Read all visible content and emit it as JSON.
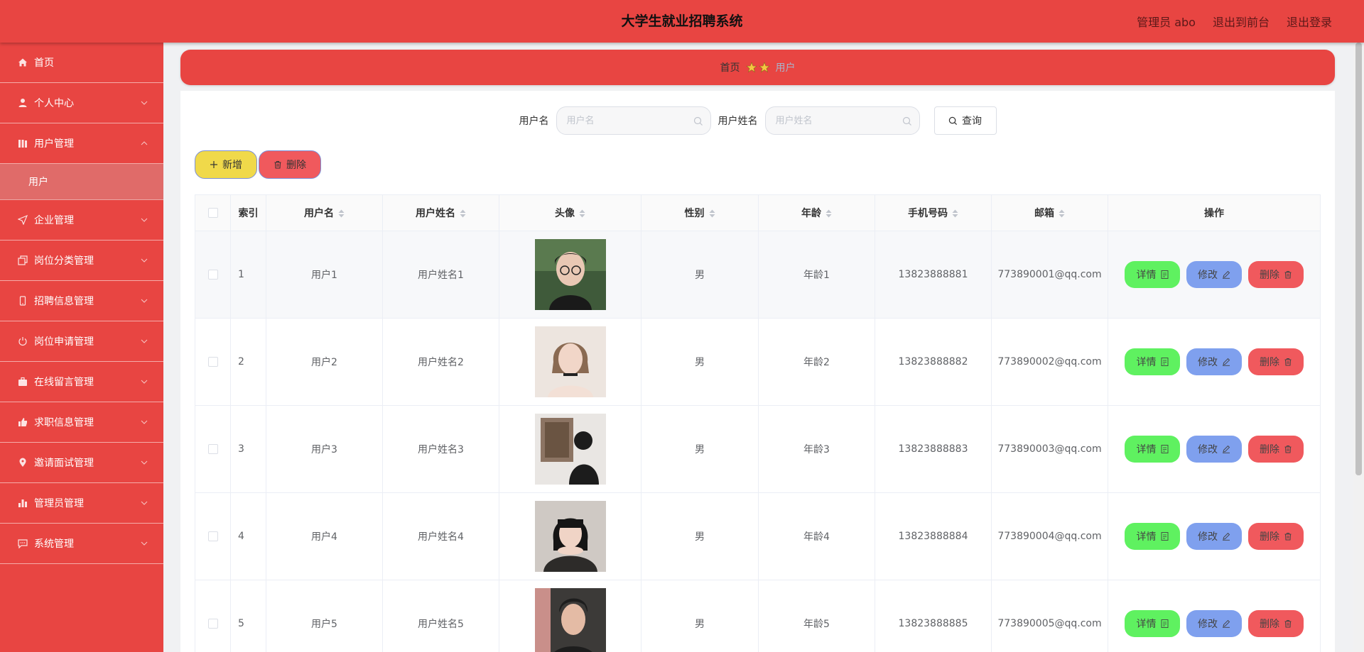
{
  "header": {
    "title": "大学生就业招聘系统",
    "admin_label": "管理员 abo",
    "to_front": "退出到前台",
    "logout": "退出登录"
  },
  "sidebar": {
    "items": [
      {
        "label": "首页",
        "icon": "home-icon"
      },
      {
        "label": "个人中心",
        "icon": "user-icon"
      },
      {
        "label": "用户管理",
        "icon": "books-icon"
      },
      {
        "label": "企业管理",
        "icon": "send-icon"
      },
      {
        "label": "岗位分类管理",
        "icon": "copy-icon"
      },
      {
        "label": "招聘信息管理",
        "icon": "phone-icon"
      },
      {
        "label": "岗位申请管理",
        "icon": "power-icon"
      },
      {
        "label": "在线留言管理",
        "icon": "briefcase-icon"
      },
      {
        "label": "求职信息管理",
        "icon": "thumb-icon"
      },
      {
        "label": "邀请面试管理",
        "icon": "location-icon"
      },
      {
        "label": "管理员管理",
        "icon": "bar-chart-icon"
      },
      {
        "label": "系统管理",
        "icon": "chat-icon"
      }
    ],
    "submenu_label": "用户"
  },
  "breadcrumb": {
    "home": "首页",
    "current": "用户"
  },
  "search": {
    "username_label": "用户名",
    "username_placeholder": "用户名",
    "realname_label": "用户姓名",
    "realname_placeholder": "用户姓名",
    "query_button": "查询"
  },
  "toolbar": {
    "add": "新增",
    "delete": "删除"
  },
  "table": {
    "headers": {
      "index": "索引",
      "username": "用户名",
      "realname": "用户姓名",
      "avatar": "头像",
      "gender": "性别",
      "age": "年龄",
      "phone": "手机号码",
      "email": "邮箱",
      "ops": "操作"
    },
    "rows": [
      {
        "index": "1",
        "username": "用户1",
        "realname": "用户姓名1",
        "gender": "男",
        "age": "年龄1",
        "phone": "13823888881",
        "email": "773890001@qq.com"
      },
      {
        "index": "2",
        "username": "用户2",
        "realname": "用户姓名2",
        "gender": "男",
        "age": "年龄2",
        "phone": "13823888882",
        "email": "773890002@qq.com"
      },
      {
        "index": "3",
        "username": "用户3",
        "realname": "用户姓名3",
        "gender": "男",
        "age": "年龄3",
        "phone": "13823888883",
        "email": "773890003@qq.com"
      },
      {
        "index": "4",
        "username": "用户4",
        "realname": "用户姓名4",
        "gender": "男",
        "age": "年龄4",
        "phone": "13823888884",
        "email": "773890004@qq.com"
      },
      {
        "index": "5",
        "username": "用户5",
        "realname": "用户姓名5",
        "gender": "男",
        "age": "年龄5",
        "phone": "13823888885",
        "email": "773890005@qq.com"
      }
    ],
    "ops": {
      "detail": "详情",
      "edit": "修改",
      "delete": "删除"
    }
  },
  "colors": {
    "brand": "#e84542",
    "detail_btn": "#5ff160",
    "edit_btn": "#7fa0ee",
    "delete_btn": "#f0595d",
    "add_btn": "#f0d94a"
  }
}
